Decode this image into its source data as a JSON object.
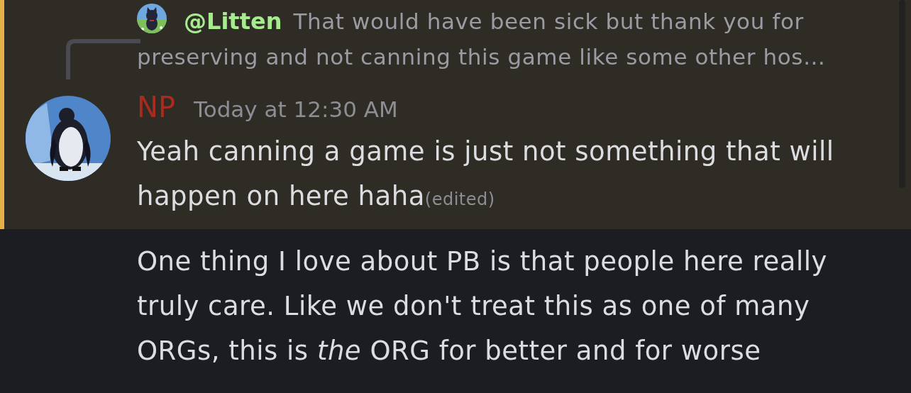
{
  "messages": [
    {
      "highlighted": true,
      "reply": {
        "author": "@Litten",
        "lines": [
          "That would have been sick but thank you for",
          "preserving and not canning this game like some other hos…"
        ]
      },
      "author": "NP",
      "timestamp": "Today at 12:30 AM",
      "text": "Yeah canning a game is just not something that will happen on here haha",
      "edited": "(edited)"
    },
    {
      "highlighted": false,
      "text": "One thing I love about PB is that people here really truly care. Like we don't treat this as one of many ORGs, this is *the* ORG for better and for worse"
    }
  ]
}
